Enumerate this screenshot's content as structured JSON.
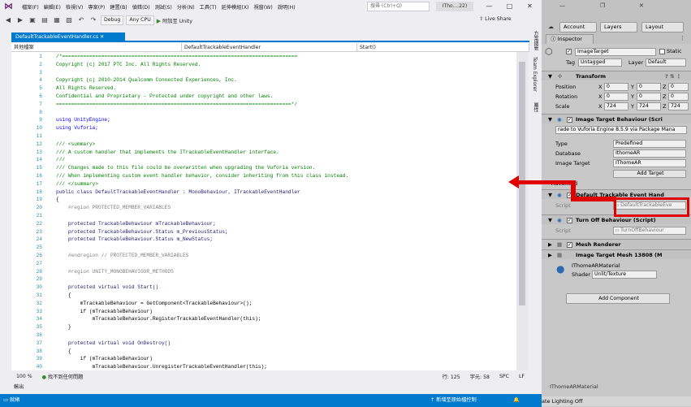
{
  "vs": {
    "menu": [
      "檔案(F)",
      "編輯(E)",
      "檢視(V)",
      "專案(P)",
      "建置(B)",
      "偵錯(D)",
      "測試(S)",
      "分析(N)",
      "工具(T)",
      "延伸模組(X)",
      "視窗(W)",
      "說明(H)"
    ],
    "search_placeholder": "搜尋 (Ctrl+Q)",
    "window_title": "ITho....22)",
    "toolbar": {
      "config": "Debug",
      "platform": "Any CPU",
      "attach": "附加至 Unity",
      "live_share": "Live Share"
    },
    "tab_label": "DefaultTrackableEventHandler.cs",
    "nav": {
      "project": "其他檔案",
      "class": "DefaultTrackableEventHandler",
      "member": "Start()"
    },
    "right_strip": [
      "方案總管",
      "Team Explorer",
      "屬性"
    ],
    "code": [
      {
        "n": "1",
        "t": "/*==============================================================================",
        "c": "com"
      },
      {
        "n": "2",
        "t": "Copyright (c) 2017 PTC Inc. All Rights Reserved.",
        "c": "com"
      },
      {
        "n": "3",
        "t": "",
        "c": "com"
      },
      {
        "n": "4",
        "t": "Copyright (c) 2010-2014 Qualcomm Connected Experiences, Inc.",
        "c": "com"
      },
      {
        "n": "5",
        "t": "All Rights Reserved.",
        "c": "com"
      },
      {
        "n": "6",
        "t": "Confidential and Proprietary - Protected under copyright and other laws.",
        "c": "com"
      },
      {
        "n": "7",
        "t": "==============================================================================*/",
        "c": "com"
      },
      {
        "n": "8",
        "t": "",
        "c": ""
      },
      {
        "n": "9",
        "t": "using UnityEngine;",
        "c": "using"
      },
      {
        "n": "10",
        "t": "using Vuforia;",
        "c": "using"
      },
      {
        "n": "11",
        "t": "",
        "c": ""
      },
      {
        "n": "12",
        "t": "/// <summary>",
        "c": "com"
      },
      {
        "n": "13",
        "t": "/// A custom handler that implements the ITrackableEventHandler interface.",
        "c": "com"
      },
      {
        "n": "14",
        "t": "///",
        "c": "com"
      },
      {
        "n": "15",
        "t": "/// Changes made to this file could be overwritten when upgrading the Vuforia version.",
        "c": "com"
      },
      {
        "n": "16",
        "t": "/// When implementing custom event handler behavior, consider inheriting from this class instead.",
        "c": "com"
      },
      {
        "n": "17",
        "t": "/// </summary>",
        "c": "com"
      },
      {
        "n": "18",
        "t": "public class DefaultTrackableEventHandler : MonoBehaviour, ITrackableEventHandler",
        "c": "class"
      },
      {
        "n": "19",
        "t": "{",
        "c": ""
      },
      {
        "n": "20",
        "t": "    #region PROTECTED_MEMBER_VARIABLES",
        "c": "region"
      },
      {
        "n": "21",
        "t": "",
        "c": ""
      },
      {
        "n": "22",
        "t": "    protected TrackableBehaviour mTrackableBehaviour;",
        "c": "prot"
      },
      {
        "n": "23",
        "t": "    protected TrackableBehaviour.Status m_PreviousStatus;",
        "c": "prot"
      },
      {
        "n": "24",
        "t": "    protected TrackableBehaviour.Status m_NewStatus;",
        "c": "prot"
      },
      {
        "n": "25",
        "t": "",
        "c": ""
      },
      {
        "n": "26",
        "t": "    #endregion // PROTECTED_MEMBER_VARIABLES",
        "c": "region"
      },
      {
        "n": "27",
        "t": "",
        "c": ""
      },
      {
        "n": "28",
        "t": "    #region UNITY_MONOBEHAVIOUR_METHODS",
        "c": "region"
      },
      {
        "n": "29",
        "t": "",
        "c": ""
      },
      {
        "n": "30",
        "t": "    protected virtual void Start()",
        "c": "prot"
      },
      {
        "n": "31",
        "t": "    {",
        "c": ""
      },
      {
        "n": "32",
        "t": "        mTrackableBehaviour = GetComponent<TrackableBehaviour>();",
        "c": ""
      },
      {
        "n": "33",
        "t": "        if (mTrackableBehaviour)",
        "c": "if"
      },
      {
        "n": "34",
        "t": "            mTrackableBehaviour.RegisterTrackableEventHandler(this);",
        "c": ""
      },
      {
        "n": "35",
        "t": "    }",
        "c": ""
      },
      {
        "n": "36",
        "t": "",
        "c": ""
      },
      {
        "n": "37",
        "t": "    protected virtual void OnDestroy()",
        "c": "prot"
      },
      {
        "n": "38",
        "t": "    {",
        "c": ""
      },
      {
        "n": "39",
        "t": "        if (mTrackableBehaviour)",
        "c": "if"
      },
      {
        "n": "40",
        "t": "            mTrackableBehaviour.UnregisterTrackableEventHandler(this);",
        "c": ""
      }
    ],
    "status_line": {
      "zoom": "100 %",
      "issues": "找不到任何問題",
      "line": "行: 125",
      "char": "字元: 58",
      "spc": "SPC",
      "lf": "LF"
    },
    "output_label": "輸出",
    "statusbar": {
      "ready": "就緒",
      "source_control": "新增至原始檔控制"
    }
  },
  "unity": {
    "account": "Account",
    "layers": "Layers",
    "layout": "Layout",
    "inspector_tab": "Inspector",
    "object_name": "ImageTarget",
    "static_label": "Static",
    "tag_label": "Tag",
    "tag_value": "Untagged",
    "layer_label": "Layer",
    "layer_value": "Default",
    "transform": {
      "title": "Transform",
      "position_label": "Position",
      "position": [
        "0",
        "0",
        "0"
      ],
      "rotation_label": "Rotation",
      "rotation": [
        "0",
        "0",
        "0"
      ],
      "scale_label": "Scale",
      "scale": [
        "724",
        "724",
        "724"
      ]
    },
    "itb": {
      "title": "Image Target Behaviour (Scri",
      "upgrade": "rade to Vuforia Engine 8.5.9 via Package Mana",
      "type_label": "Type",
      "type_value": "Predefined",
      "db_label": "Database",
      "db_value": "IthomeAR",
      "it_label": "Image Target",
      "it_value": "IThomeAR",
      "add_target": "Add Target",
      "advanced": "Advanced"
    },
    "dteh": {
      "title": "Default Trackable Event Hand",
      "script_label": "Script",
      "script_value": "DefaultTrackableEve"
    },
    "turnoff": {
      "title": "Turn Off Behaviour (Script)",
      "script_label": "Script",
      "script_value": "TurnOffBehaviour"
    },
    "mesh_renderer": "Mesh Renderer",
    "itmesh": "Image Target Mesh 13808 (M",
    "material": {
      "name": "IThomeARMaterial",
      "shader_label": "Shader",
      "shader_value": "Unlit/Texture"
    },
    "add_component": "Add Component",
    "footer_material": "IThomeARMaterial",
    "lighting": "ate Lighting Off"
  }
}
